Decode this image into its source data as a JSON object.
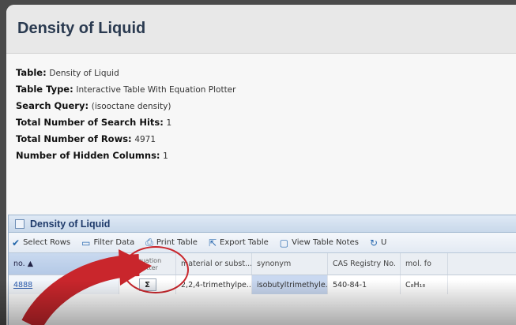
{
  "title": "Density of Liquid",
  "info": [
    {
      "label": "Table:",
      "value": "Density of Liquid"
    },
    {
      "label": "Table Type:",
      "value": "Interactive Table With Equation Plotter"
    },
    {
      "label": "Search Query:",
      "value": "(isooctane density)"
    },
    {
      "label": "Total Number of Search Hits:",
      "value": "1"
    },
    {
      "label": "Total Number of Rows:",
      "value": "4971"
    },
    {
      "label": "Number of Hidden Columns:",
      "value": "1"
    }
  ],
  "panel": {
    "title": "Density of Liquid",
    "toolbar": {
      "select_rows": "Select Rows",
      "filter_data": "Filter Data",
      "print_table": "Print Table",
      "export_table": "Export Table",
      "view_notes": "View Table Notes",
      "undo": "U"
    },
    "columns": {
      "no": "no. ▲",
      "eq_line1": "equation",
      "eq_line2": "plotter",
      "material": "material or subst...",
      "synonym": "synonym",
      "cas": "CAS Registry No.",
      "mol": "mol. fo"
    },
    "row": {
      "no": "4888",
      "sigma": "Σ",
      "material": "2,2,4-trimethylpe...",
      "synonym": "isobutyltrimethyle...",
      "cas": "540-84-1",
      "mol": "C₈H₁₈"
    }
  },
  "colors": {
    "highlight": "#c9262c",
    "panel_header": "#c8d8ea"
  }
}
